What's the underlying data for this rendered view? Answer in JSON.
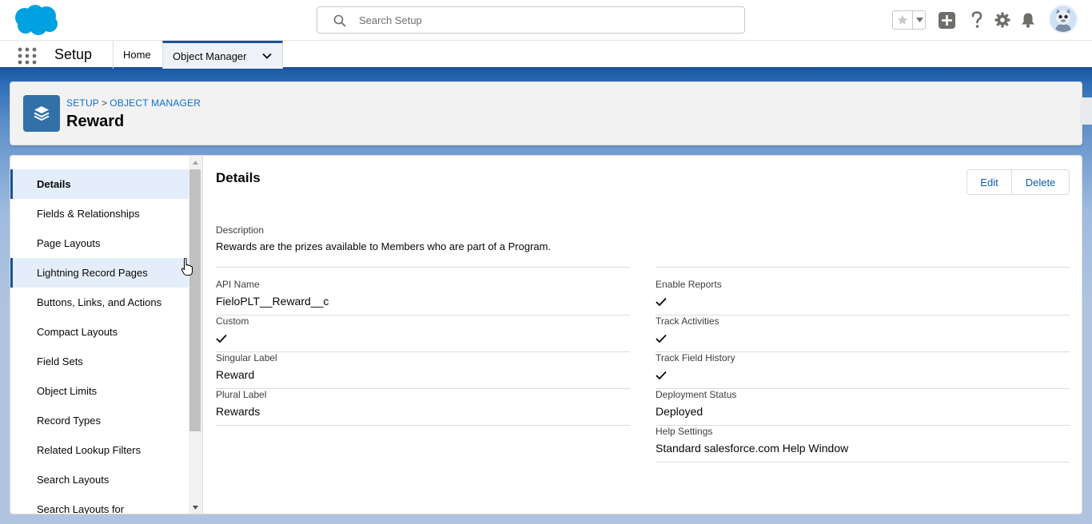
{
  "header": {
    "search_placeholder": "Search Setup"
  },
  "context_bar": {
    "app_name": "Setup",
    "tabs": [
      {
        "label": "Home"
      },
      {
        "label": "Object Manager"
      }
    ]
  },
  "page_header": {
    "breadcrumb": [
      "SETUP",
      "OBJECT MANAGER"
    ],
    "breadcrumb_separator": ">",
    "title": "Reward"
  },
  "sidebar": {
    "items": [
      {
        "label": "Details"
      },
      {
        "label": "Fields & Relationships"
      },
      {
        "label": "Page Layouts"
      },
      {
        "label": "Lightning Record Pages"
      },
      {
        "label": "Buttons, Links, and Actions"
      },
      {
        "label": "Compact Layouts"
      },
      {
        "label": "Field Sets"
      },
      {
        "label": "Object Limits"
      },
      {
        "label": "Record Types"
      },
      {
        "label": "Related Lookup Filters"
      },
      {
        "label": "Search Layouts"
      },
      {
        "label": "Search Layouts for"
      }
    ]
  },
  "details": {
    "title": "Details",
    "edit_label": "Edit",
    "delete_label": "Delete",
    "description_label": "Description",
    "description_value": "Rewards are the prizes available to Members who are part of a Program.",
    "left_fields": [
      {
        "label": "API Name",
        "value": "FieloPLT__Reward__c"
      },
      {
        "label": "Custom",
        "value": ""
      },
      {
        "label": "Singular Label",
        "value": "Reward"
      },
      {
        "label": "Plural Label",
        "value": "Rewards"
      }
    ],
    "right_fields": [
      {
        "label": "Enable Reports",
        "value": ""
      },
      {
        "label": "Track Activities",
        "value": ""
      },
      {
        "label": "Track Field History",
        "value": ""
      },
      {
        "label": "Deployment Status",
        "value": "Deployed"
      },
      {
        "label": "Help Settings",
        "value": "Standard salesforce.com Help Window"
      }
    ]
  },
  "colors": {
    "brand_blue": "#1b5297",
    "link_blue": "#0b6ed1",
    "object_icon": "#3171a8",
    "salesforce_cloud": "#00a1e0"
  }
}
